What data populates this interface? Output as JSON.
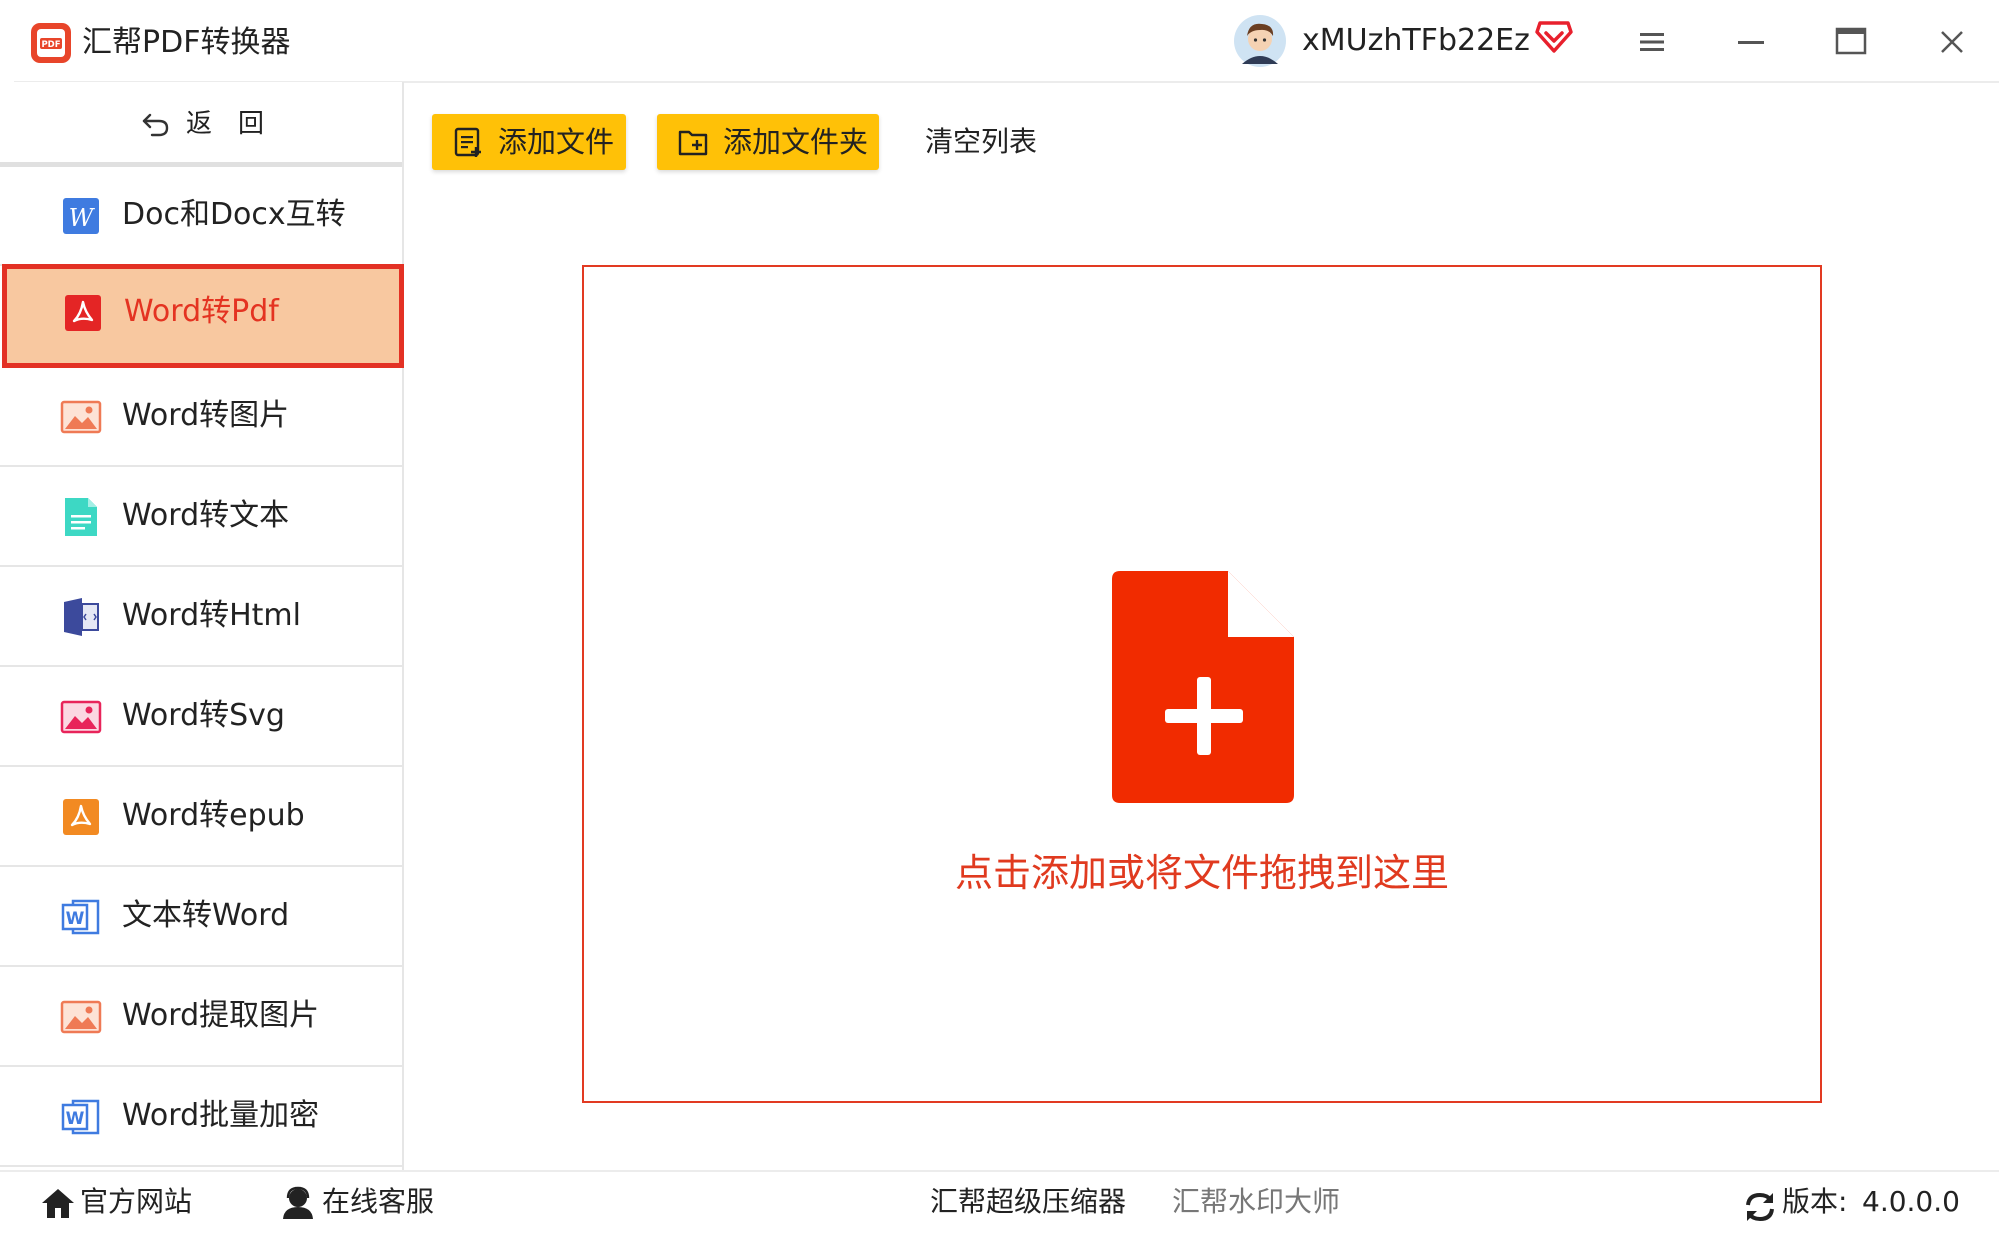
{
  "app": {
    "title": "汇帮PDF转换器",
    "logo_text": "PDF",
    "username": "xMUzhTFb22Ez"
  },
  "colors": {
    "accent_red": "#e43321",
    "button_yellow": "#ffc107",
    "active_bg": "#f8c8a0",
    "drop_icon_red": "#f12b00"
  },
  "sidebar": {
    "back_label": "返回",
    "items": [
      {
        "label": "Doc和Docx互转",
        "icon": "word-w-icon",
        "active": false
      },
      {
        "label": "Word转Pdf",
        "icon": "pdf-icon",
        "active": true
      },
      {
        "label": "Word转图片",
        "icon": "image-icon",
        "active": false
      },
      {
        "label": "Word转文本",
        "icon": "text-file-icon",
        "active": false
      },
      {
        "label": "Word转Html",
        "icon": "html-icon",
        "active": false
      },
      {
        "label": "Word转Svg",
        "icon": "svg-image-icon",
        "active": false
      },
      {
        "label": "Word转epub",
        "icon": "epub-icon",
        "active": false
      },
      {
        "label": "文本转Word",
        "icon": "word-doc-icon",
        "active": false
      },
      {
        "label": "Word提取图片",
        "icon": "extract-image-icon",
        "active": false
      },
      {
        "label": "Word批量加密",
        "icon": "encrypt-word-icon",
        "active": false
      }
    ]
  },
  "toolbar": {
    "add_file": "添加文件",
    "add_folder": "添加文件夹",
    "clear_list": "清空列表"
  },
  "dropzone": {
    "text": "点击添加或将文件拖拽到这里"
  },
  "bottom": {
    "official_site": "官方网站",
    "online_service": "在线客服",
    "compressor": "汇帮超级压缩器",
    "watermark": "汇帮水印大师",
    "version_label": "版本:",
    "version_value": "4.0.0.0"
  }
}
